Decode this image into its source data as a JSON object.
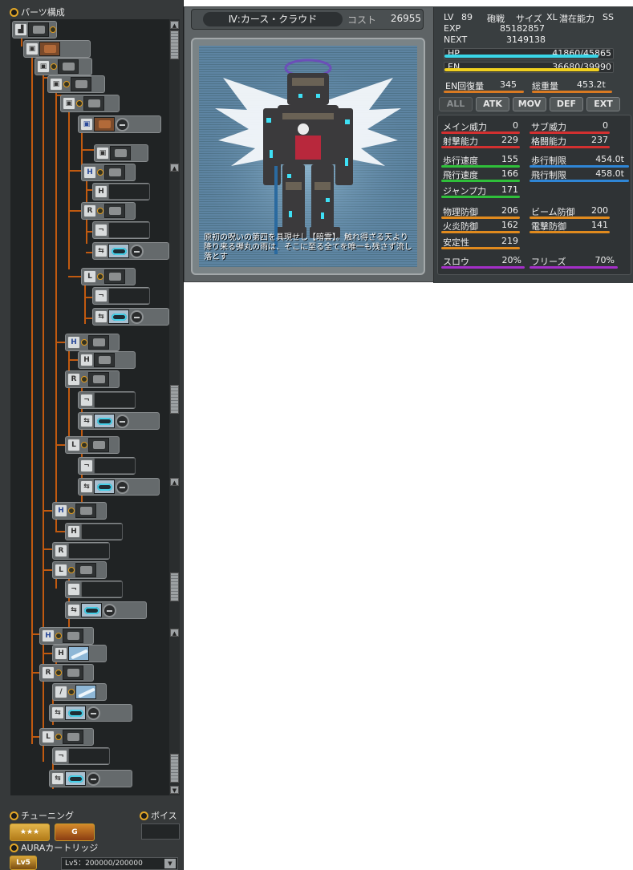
{
  "parts_panel": {
    "title": "パーツ構成",
    "tuning_label": "チューニング",
    "voice_label": "ボイス",
    "aura_label": "AURAカートリッジ",
    "aura_level": "Lv5：200000/200000",
    "tuning_badge_1": "★★★",
    "tuning_badge_2": "G",
    "aura_badge": "Lv5"
  },
  "mech": {
    "name": "Ⅳ:カース・クラウド",
    "cost_label": "コスト",
    "cost": "26955",
    "description": "原初の呪いの第四を具現せし【暗雲】。触れ得ざる天より降り来る弾丸の雨は、そこに至る全てを唯一も残さず流し落とす"
  },
  "stats": {
    "lv_label": "LV",
    "lv": "89",
    "type": "砲戦",
    "size_label": "サイズ",
    "size": "XL",
    "potential_label": "潜在能力",
    "potential": "SS",
    "exp_label": "EXP",
    "exp": "85182857",
    "next_label": "NEXT",
    "next": "3149138",
    "hp_label": "HP",
    "hp": "41860/45865",
    "hp_ratio": 0.913,
    "en_label": "EN",
    "en": "36680/39990",
    "en_ratio": 0.917,
    "en_regen_label": "EN回復量",
    "en_regen": "345",
    "weight_label": "総重量",
    "weight": "453.2t",
    "tabs": [
      "ALL",
      "ATK",
      "MOV",
      "DEF",
      "EXT"
    ],
    "main_power_label": "メイン威力",
    "main_power": "0",
    "sub_power_label": "サブ威力",
    "sub_power": "0",
    "shoot_label": "射撃能力",
    "shoot": "229",
    "melee_label": "格闘能力",
    "melee": "237",
    "walk_speed_label": "歩行速度",
    "walk_speed": "155",
    "walk_limit_label": "歩行制限",
    "walk_limit": "454.0t",
    "fly_speed_label": "飛行速度",
    "fly_speed": "166",
    "fly_limit_label": "飛行制限",
    "fly_limit": "458.0t",
    "jump_label": "ジャンプ力",
    "jump": "171",
    "phys_def_label": "物理防御",
    "phys_def": "206",
    "beam_def_label": "ビーム防御",
    "beam_def": "200",
    "fire_def_label": "火炎防御",
    "fire_def": "162",
    "elec_def_label": "電撃防御",
    "elec_def": "141",
    "stability_label": "安定性",
    "stability": "219",
    "slow_label": "スロウ",
    "slow": "20%",
    "freeze_label": "フリーズ",
    "freeze": "70%"
  },
  "colors": {
    "hp": "#3ad6e8",
    "en": "#f0d020",
    "accent": "#c15a10"
  }
}
